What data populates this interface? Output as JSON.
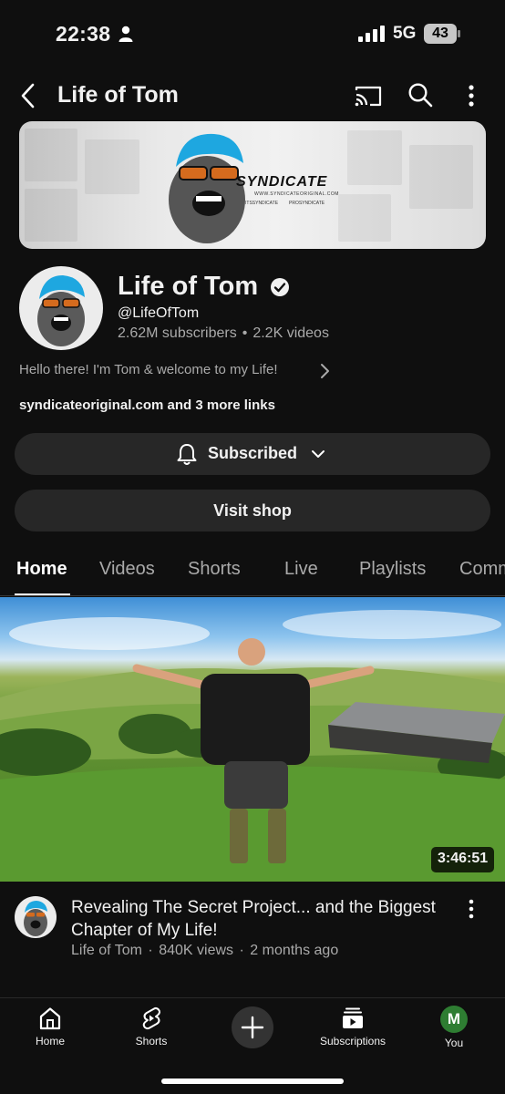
{
  "status_bar": {
    "time": "22:38",
    "network": "5G",
    "battery": "43"
  },
  "top_bar": {
    "title": "Life of Tom"
  },
  "banner": {
    "brand": "SYNDICATE",
    "url": "WWW.SYNDICATEORIGINAL.COM",
    "social_1": "ITSSYNDICATE",
    "social_2": "PROSYNDICATE"
  },
  "channel": {
    "name": "Life of Tom",
    "handle": "@LifeOfTom",
    "subscribers": "2.62M subscribers",
    "videos": "2.2K videos",
    "separator": "•",
    "description": "Hello there! I'm Tom & welcome to my Life!",
    "links": "syndicateoriginal.com and 3 more links"
  },
  "buttons": {
    "subscribed": "Subscribed",
    "visit_shop": "Visit shop"
  },
  "tabs": [
    {
      "label": "Home",
      "active": true
    },
    {
      "label": "Videos"
    },
    {
      "label": "Shorts"
    },
    {
      "label": "Live"
    },
    {
      "label": "Playlists"
    },
    {
      "label": "Comm"
    }
  ],
  "video": {
    "duration": "3:46:51",
    "title": "Revealing The Secret Project... and the Biggest Chapter of My Life!",
    "channel": "Life of Tom",
    "separator": "·",
    "views": "840K views",
    "age": "2 months ago"
  },
  "bottom_nav": {
    "home": "Home",
    "shorts": "Shorts",
    "subscriptions": "Subscriptions",
    "you": "You",
    "you_initial": "M"
  },
  "icons": [
    "person-icon",
    "signal-icon",
    "battery-icon",
    "back-icon",
    "cast-icon",
    "search-icon",
    "more-vert-icon",
    "verified-icon",
    "chevron-right-icon",
    "bell-icon",
    "chevron-down-icon",
    "home-icon",
    "shorts-icon",
    "create-plus-icon",
    "subscriptions-icon"
  ],
  "colors": {
    "background": "#0f0f0f",
    "surface": "#272727",
    "secondary_text": "#aaaaaa",
    "avatar_green": "#2e7d32"
  }
}
